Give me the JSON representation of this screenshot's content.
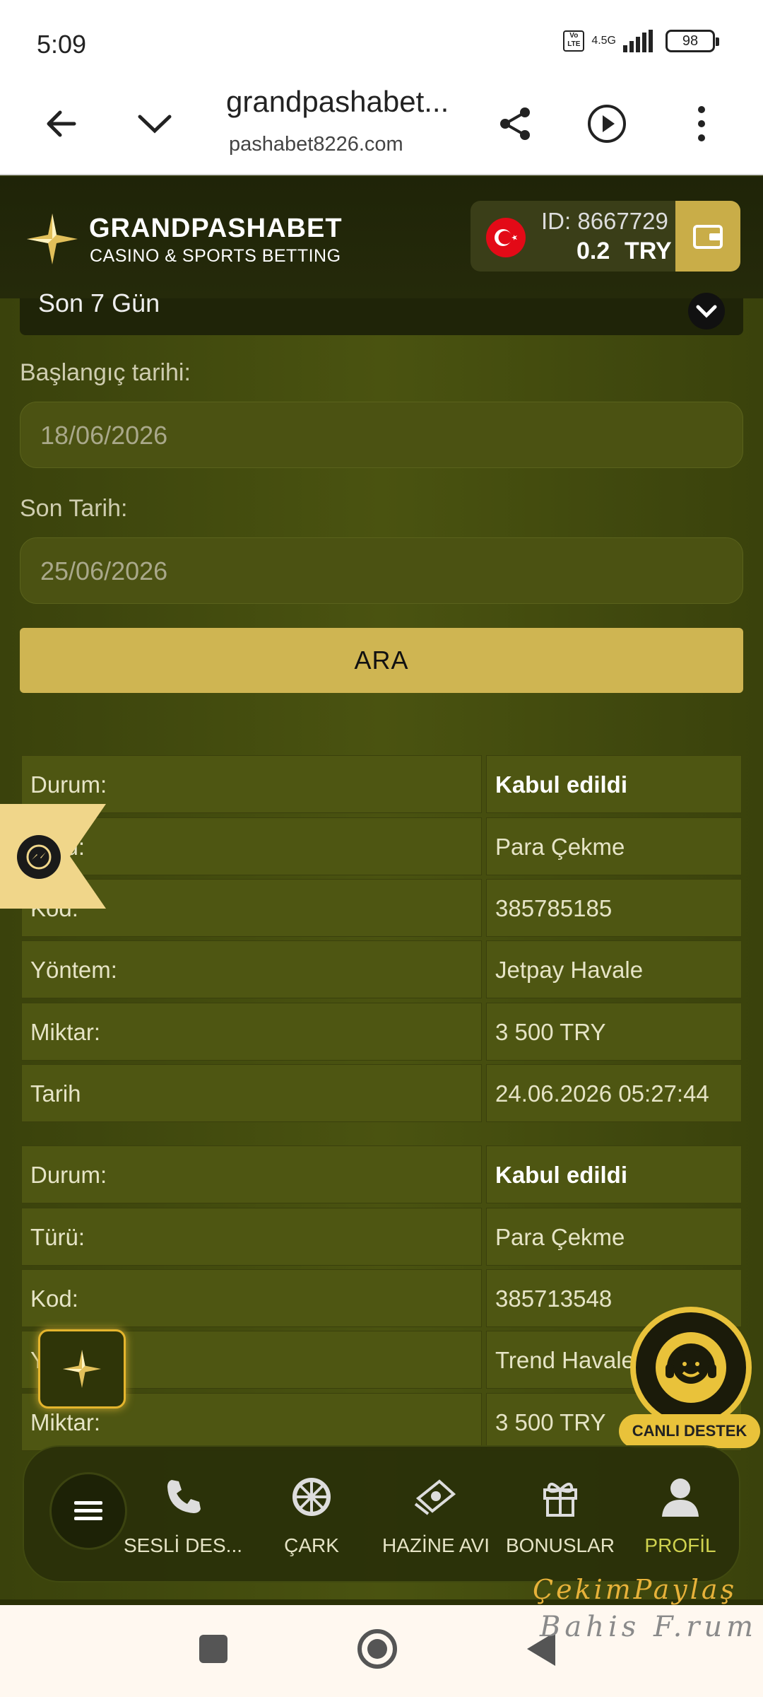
{
  "status_bar": {
    "time": "5:09",
    "network": "4.5G",
    "volte": "Vo LTE",
    "battery": "98"
  },
  "browser": {
    "title": "grandpashabet...",
    "url": "pashabet8226.com"
  },
  "header": {
    "brand": "GRANDPASHABET",
    "tagline": "CASINO & SPORTS BETTING",
    "account_id": "ID: 8667729",
    "balance": "0.2",
    "currency": "TRY"
  },
  "filter": {
    "period": "Son 7 Gün",
    "start_label": "Başlangıç tarihi:",
    "start_value": "18/06/2026",
    "end_label": "Son Tarih:",
    "end_value": "25/06/2026",
    "search_button": "ARA"
  },
  "transactions": [
    {
      "rows": [
        {
          "label": "Durum:",
          "value": "Kabul edildi"
        },
        {
          "label": "Türü:",
          "value": "Para Çekme"
        },
        {
          "label": "Kod:",
          "value": "385785185"
        },
        {
          "label": "Yöntem:",
          "value": "Jetpay Havale"
        },
        {
          "label": "Miktar:",
          "value": "3 500 TRY"
        },
        {
          "label": "Tarih",
          "value": "24.06.2026 05:27:44"
        }
      ]
    },
    {
      "rows": [
        {
          "label": "Durum:",
          "value": "Kabul edildi"
        },
        {
          "label": "Türü:",
          "value": "Para Çekme"
        },
        {
          "label": "Kod:",
          "value": "385713548"
        },
        {
          "label": "Yöntem:",
          "value": "Trend Havale"
        },
        {
          "label": "Miktar:",
          "value": "3 500 TRY"
        }
      ]
    }
  ],
  "floating": {
    "live_support": "CANLI DESTEK"
  },
  "bottom_nav": {
    "items": [
      {
        "label": "SESLİ DES...",
        "icon": "phone-icon"
      },
      {
        "label": "ÇARK",
        "icon": "wheel-icon"
      },
      {
        "label": "HAZİNE AVI",
        "icon": "money-icon"
      },
      {
        "label": "BONUSLAR",
        "icon": "gift-icon"
      },
      {
        "label": "PROFİL",
        "icon": "user-icon"
      }
    ]
  },
  "watermark": {
    "line1": "ÇekimPaylaş",
    "line2": "Bahis F.rum"
  }
}
